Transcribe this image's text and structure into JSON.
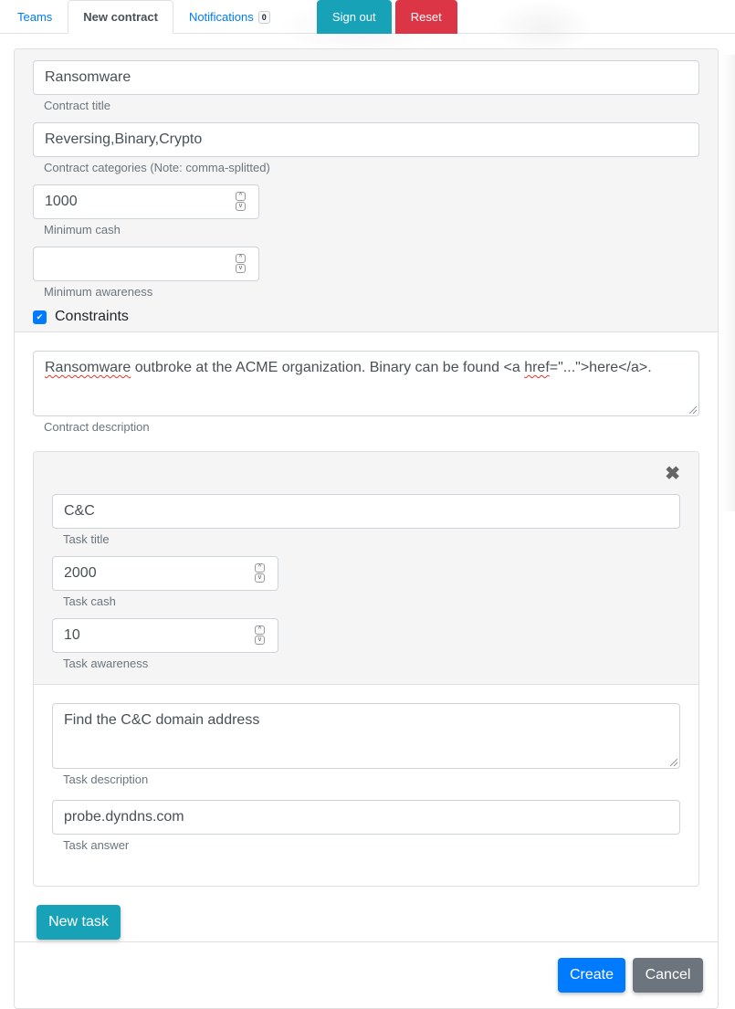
{
  "nav": {
    "tabs": [
      {
        "label": "Teams",
        "active": false
      },
      {
        "label": "New contract",
        "active": true
      },
      {
        "label": "Notifications",
        "active": false,
        "badge": "0"
      }
    ],
    "sign_out_label": "Sign out",
    "reset_label": "Reset"
  },
  "contract": {
    "title": {
      "value": "Ransomware",
      "help": "Contract title"
    },
    "categories": {
      "value": "Reversing,Binary,Crypto",
      "help": "Contract categories (Note: comma-splitted)"
    },
    "min_cash": {
      "value": "1000",
      "help": "Minimum cash"
    },
    "min_awareness": {
      "value": "",
      "help": "Minimum awareness"
    },
    "constraints": {
      "label": "Constraints",
      "checked": true
    },
    "description": {
      "value_parts": [
        "Ransomware",
        " outbroke at the ACME organization. Binary can be found <a ",
        "href",
        "=\"...\">here</a>."
      ],
      "help": "Contract description"
    }
  },
  "tasks": [
    {
      "title": {
        "value": "C&C",
        "help": "Task title"
      },
      "cash": {
        "value": "2000",
        "help": "Task cash"
      },
      "awareness": {
        "value": "10",
        "help": "Task awareness"
      },
      "description": {
        "value": "Find the C&C domain address",
        "help": "Task description"
      },
      "answer": {
        "value": "probe.dyndns.com",
        "help": "Task answer"
      }
    }
  ],
  "actions": {
    "new_task_label": "New task",
    "create_label": "Create",
    "cancel_label": "Cancel"
  },
  "icons": {
    "close": "✖",
    "check": "✔",
    "spin_up": "^",
    "spin_down": "v"
  },
  "colors": {
    "primary": "#007bff",
    "info": "#17a2b8",
    "danger": "#dc3545",
    "secondary": "#6c757d"
  }
}
